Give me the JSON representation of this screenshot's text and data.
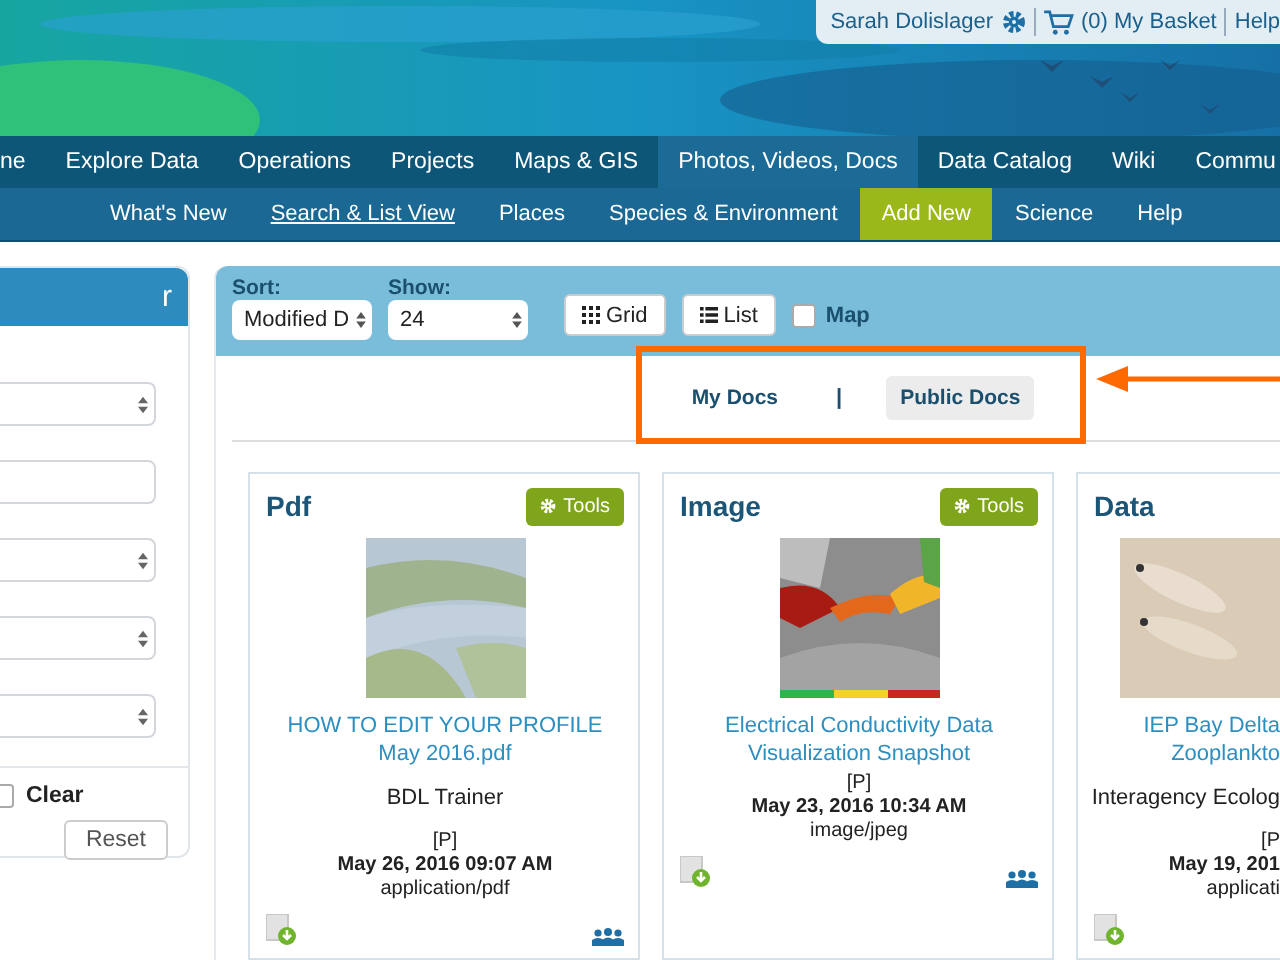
{
  "user_bar": {
    "user": "Sarah Dolislager",
    "basket": "(0) My Basket",
    "help": "Help"
  },
  "main_nav": [
    {
      "label": "ne",
      "selected": false
    },
    {
      "label": "Explore Data",
      "selected": false
    },
    {
      "label": "Operations",
      "selected": false
    },
    {
      "label": "Projects",
      "selected": false
    },
    {
      "label": "Maps & GIS",
      "selected": false
    },
    {
      "label": "Photos, Videos, Docs",
      "selected": true
    },
    {
      "label": "Data Catalog",
      "selected": false
    },
    {
      "label": "Wiki",
      "selected": false
    },
    {
      "label": "Commu",
      "selected": false
    }
  ],
  "sub_nav": [
    {
      "label": "What's New",
      "selected": false,
      "kind": "link"
    },
    {
      "label": "Search & List View",
      "selected": true,
      "kind": "link"
    },
    {
      "label": "Places",
      "selected": false,
      "kind": "link"
    },
    {
      "label": "Species & Environment",
      "selected": false,
      "kind": "link"
    },
    {
      "label": "Add New",
      "selected": false,
      "kind": "action"
    },
    {
      "label": "Science",
      "selected": false,
      "kind": "link"
    },
    {
      "label": "Help",
      "selected": false,
      "kind": "link"
    }
  ],
  "sidebar": {
    "title": "r",
    "fields": [
      {
        "kind": "select"
      },
      {
        "kind": "input"
      },
      {
        "kind": "select"
      },
      {
        "kind": "select"
      },
      {
        "kind": "select"
      }
    ],
    "clear": {
      "label": "Clear",
      "checked": false
    },
    "reset": "Reset"
  },
  "toolbar": {
    "sort": {
      "label": "Sort:",
      "value": "Modified D"
    },
    "show": {
      "label": "Show:",
      "value": "24"
    },
    "views": [
      {
        "label": "Grid",
        "kind": "grid"
      },
      {
        "label": "List",
        "kind": "list"
      }
    ],
    "map": {
      "label": "Map",
      "checked": false
    }
  },
  "doc_tabs": [
    {
      "label": "My Docs",
      "selected": false
    },
    {
      "label": "Public Docs",
      "selected": true
    }
  ],
  "doc_tabs_separator": "|",
  "cards": [
    {
      "type": "Pdf",
      "tools": "Tools",
      "title": "HOW TO EDIT YOUR PROFILE May 2016.pdf",
      "author": "BDL Trainer",
      "flag": "[P]",
      "date": "May 26, 2016 09:07 AM",
      "mime": "application/pdf",
      "shared": true
    },
    {
      "type": "Image",
      "tools": "Tools",
      "title": "Electrical Conductivity Data Visualization Snapshot",
      "flag": "[P]",
      "date": "May 23, 2016 10:34 AM",
      "mime": "image/jpeg",
      "shared": true
    },
    {
      "type": "Data",
      "title": "IEP Bay Delta Zooplankto",
      "author": "Interagency Ecolog",
      "flag": "[P",
      "date": "May 19, 201",
      "mime": "applicati",
      "shared": false
    }
  ]
}
